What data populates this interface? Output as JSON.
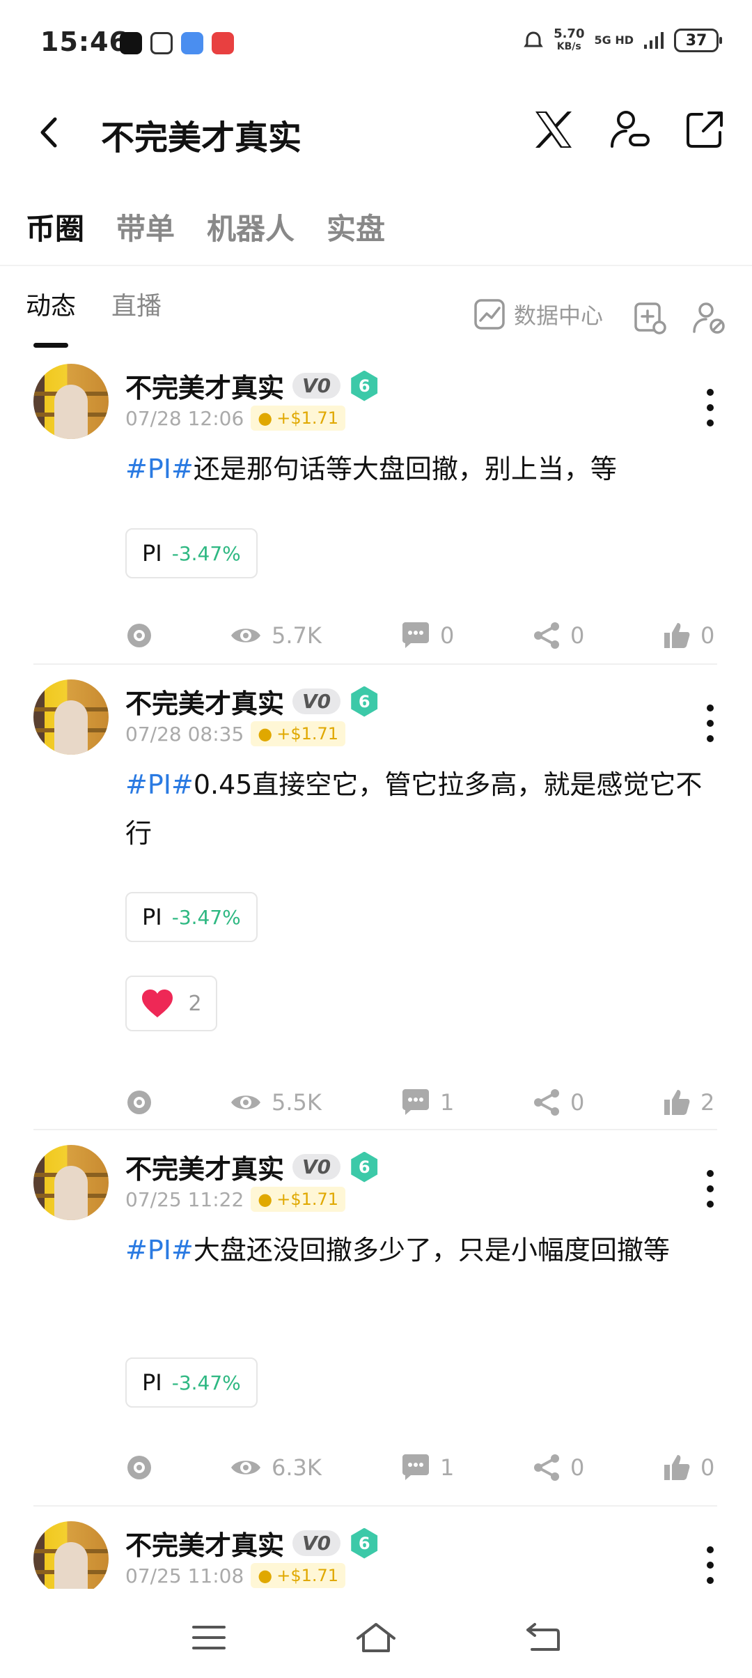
{
  "status_bar": {
    "time": "15:46",
    "net_speed": "5.70",
    "net_unit": "KB/s",
    "network": "5G HD",
    "battery": "37"
  },
  "header": {
    "title": "不完美才真实"
  },
  "main_tabs": [
    "币圈",
    "带单",
    "机器人",
    "实盘"
  ],
  "sub_tabs": [
    "动态",
    "直播"
  ],
  "data_center_label": "数据中心",
  "posts": [
    {
      "name": "不完美才真实",
      "vip": "V0",
      "level": "6",
      "time": "07/28 12:06",
      "reward": "+$1.71",
      "tag": "#PI#",
      "text": "还是那句话等大盘回撤，别上当，等",
      "coin": "PI",
      "change": "-3.47%",
      "views": "5.7K",
      "comments": "0",
      "shares": "0",
      "likes": "0"
    },
    {
      "name": "不完美才真实",
      "vip": "V0",
      "level": "6",
      "time": "07/28 08:35",
      "reward": "+$1.71",
      "tag": "#PI#",
      "text": "0.45直接空它，管它拉多高，就是感觉它不行",
      "coin": "PI",
      "change": "-3.47%",
      "reaction_count": "2",
      "views": "5.5K",
      "comments": "1",
      "shares": "0",
      "likes": "2"
    },
    {
      "name": "不完美才真实",
      "vip": "V0",
      "level": "6",
      "time": "07/25 11:22",
      "reward": "+$1.71",
      "tag": "#PI#",
      "text": "大盘还没回撤多少了，只是小幅度回撤等",
      "coin": "PI",
      "change": "-3.47%",
      "views": "6.3K",
      "comments": "1",
      "shares": "0",
      "likes": "0"
    },
    {
      "name": "不完美才真实",
      "vip": "V0",
      "level": "6",
      "time": "07/25 11:08",
      "reward": "+$1.71"
    }
  ],
  "colors": {
    "tag_blue": "#2a7ae2",
    "change_green": "#2eb882",
    "level_badge": "#3cc9a8",
    "reward_gold": "#e0a800"
  }
}
